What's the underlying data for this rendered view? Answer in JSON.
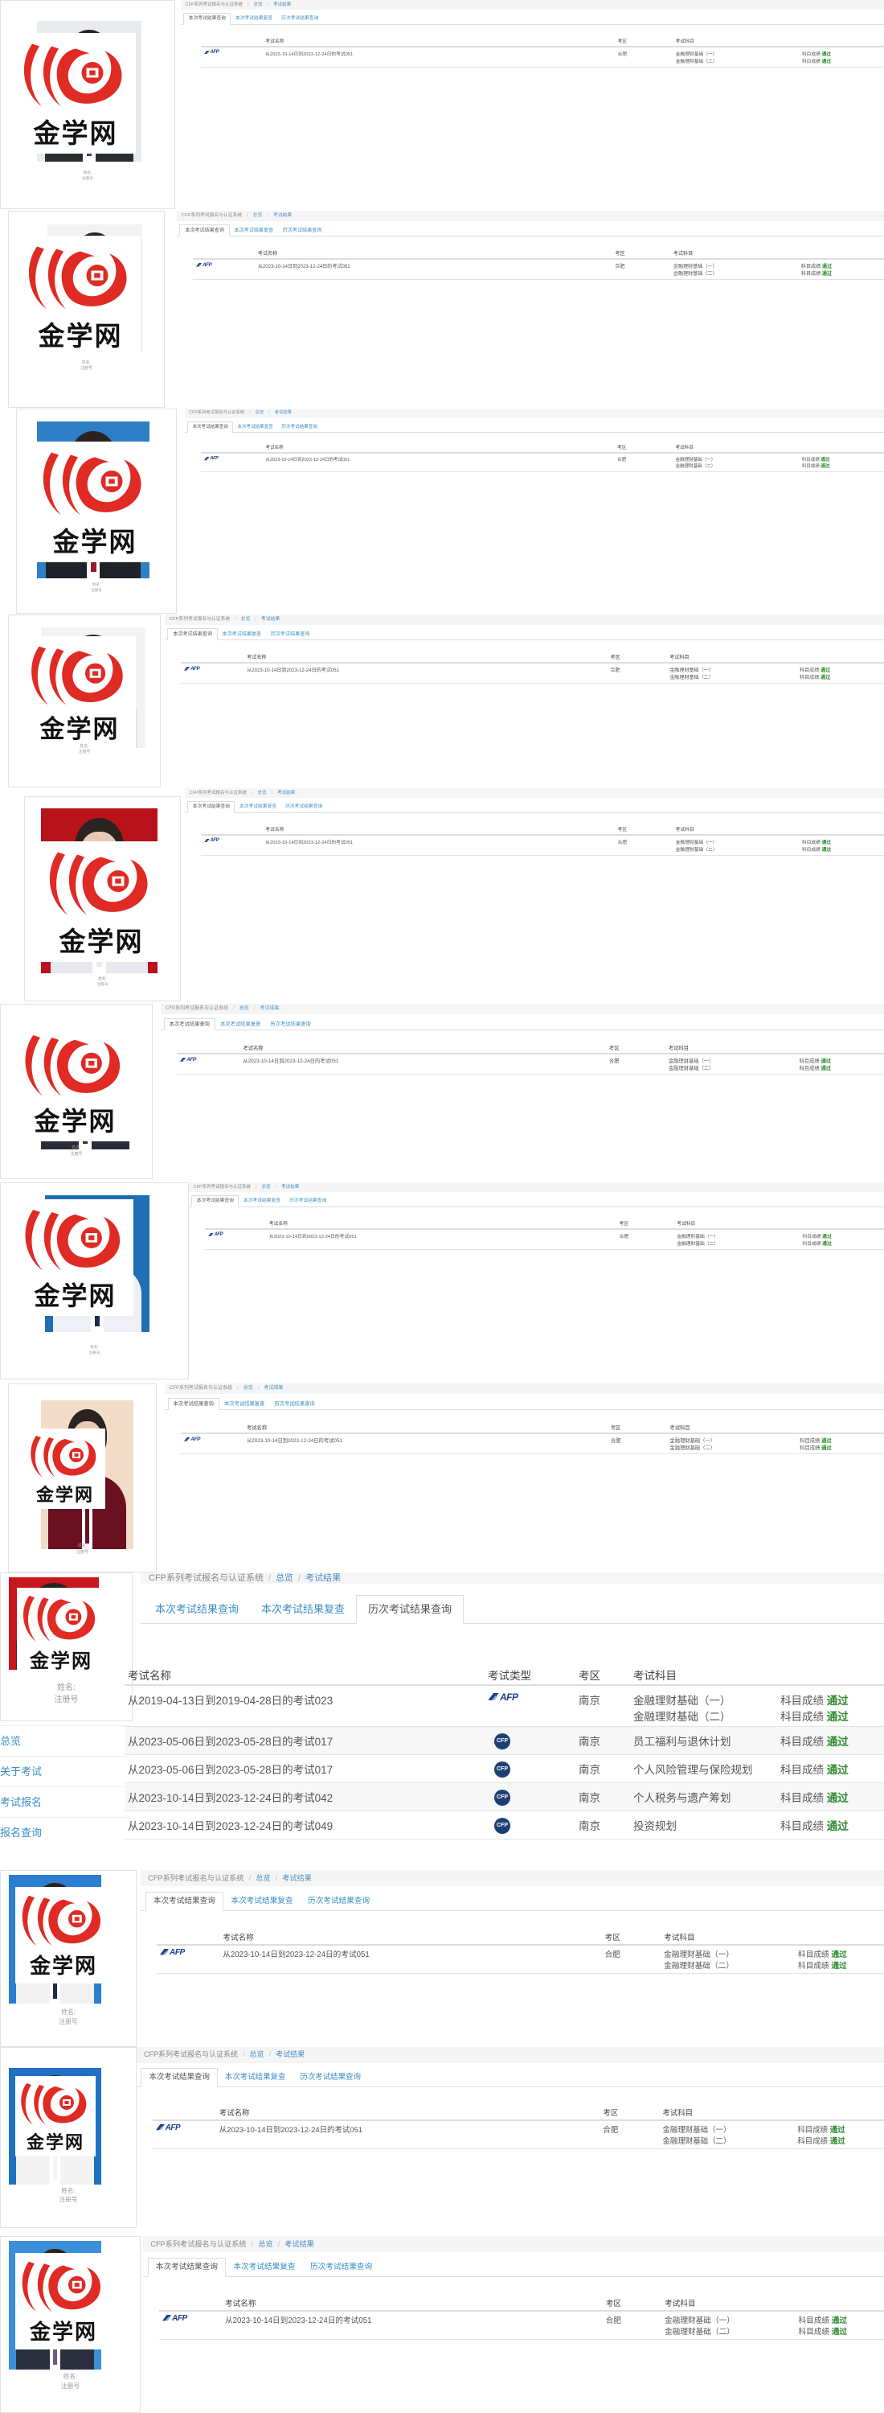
{
  "logo_text": "金学网",
  "brand_color": "#e02a24",
  "pass_color": "#2e8b2e",
  "breadcrumb": {
    "system": "CFP系列考试报名与认证系统",
    "home": "总览",
    "current": "考试结果"
  },
  "tabs": [
    "本次考试结果查询",
    "本次考试结果复查",
    "历次考试结果查询"
  ],
  "table": {
    "headers": {
      "exam_name": "考试名称",
      "exam_type": "考试类型",
      "area": "考区",
      "subjects": "考试科目"
    }
  },
  "current_exam": {
    "type_logo": "AFP",
    "name": "从2023-10-14日到2023-12-24日的考试051",
    "area": "合肥",
    "subjects": [
      {
        "name": "金融理财基础（一）",
        "score_label": "科目成绩",
        "result": "通过"
      },
      {
        "name": "金融理财基础（二）",
        "score_label": "科目成绩",
        "result": "通过"
      }
    ]
  },
  "user": {
    "name_label": "姓名:",
    "reg_label": "注册号"
  },
  "history": {
    "rows": [
      {
        "name": "从2019-04-13日到2019-04-28日的考试023",
        "type": "AFP",
        "area": "南京",
        "subjects": [
          {
            "name": "金融理财基础（一）",
            "score_label": "科目成绩",
            "result": "通过"
          },
          {
            "name": "金融理财基础（二）",
            "score_label": "科目成绩",
            "result": "通过"
          }
        ]
      },
      {
        "name": "从2023-05-06日到2023-05-28日的考试017",
        "type": "CFP",
        "area": "南京",
        "subjects": [
          {
            "name": "员工福利与退休计划",
            "score_label": "科目成绩",
            "result": "通过"
          }
        ]
      },
      {
        "name": "从2023-05-06日到2023-05-28日的考试017",
        "type": "CFP",
        "area": "南京",
        "subjects": [
          {
            "name": "个人风险管理与保险规划",
            "score_label": "科目成绩",
            "result": "通过"
          }
        ]
      },
      {
        "name": "从2023-10-14日到2023-12-24日的考试042",
        "type": "CFP",
        "area": "南京",
        "subjects": [
          {
            "name": "个人税务与遗产筹划",
            "score_label": "科目成绩",
            "result": "通过"
          }
        ]
      },
      {
        "name": "从2023-10-14日到2023-12-24日的考试049",
        "type": "CFP",
        "area": "南京",
        "subjects": [
          {
            "name": "投资规划",
            "score_label": "科目成绩",
            "result": "通过"
          }
        ]
      }
    ],
    "sidenav": [
      "总览",
      "关于考试",
      "考试报名",
      "报名查询"
    ]
  },
  "variants": [
    {
      "photo_bg": "#e9ecef",
      "suit": "#2b2d33",
      "tie": "#4a3c7a",
      "active_tab": 0
    },
    {
      "photo_bg": "#f1f1f1",
      "suit": "#f4f4f4",
      "tie": "#e6e6e6",
      "active_tab": 0
    },
    {
      "photo_bg": "#2f7fc7",
      "suit": "#1f2228",
      "tie": "#9b1b2a",
      "active_tab": 0
    },
    {
      "photo_bg": "#f3f3f3",
      "suit": "#e8e2da",
      "tie": "#d9d0c6",
      "active_tab": 0
    },
    {
      "photo_bg": "#b8121b",
      "suit": "#e8e8ef",
      "tie": "#e8e8ef",
      "active_tab": 0
    },
    {
      "photo_bg": "#ffffff",
      "suit": "#2a2c36",
      "tie": "#2a2c36",
      "active_tab": 0
    },
    {
      "photo_bg": "#1f6fb5",
      "suit": "#eef0f5",
      "tie": "#1e2a4a",
      "active_tab": 0
    },
    {
      "photo_bg": "#f2dcc8",
      "suit": "#6b1020",
      "tie": "#6b1020",
      "active_tab": 0
    },
    {
      "photo_bg": "#c8161e",
      "suit": "#2a2c36",
      "tie": "#2a2c36",
      "active_tab": 2
    },
    {
      "photo_bg": "#2b7ed0",
      "suit": "#f1f1f1",
      "tie": "#1f2a44",
      "active_tab": 0
    },
    {
      "photo_bg": "#1f72c2",
      "suit": "#f3f3f3",
      "tie": "#f3f3f3",
      "active_tab": 0
    },
    {
      "photo_bg": "#3b8fd8",
      "suit": "#2b2f3d",
      "tie": "#6a5a8c",
      "active_tab": 0
    }
  ]
}
